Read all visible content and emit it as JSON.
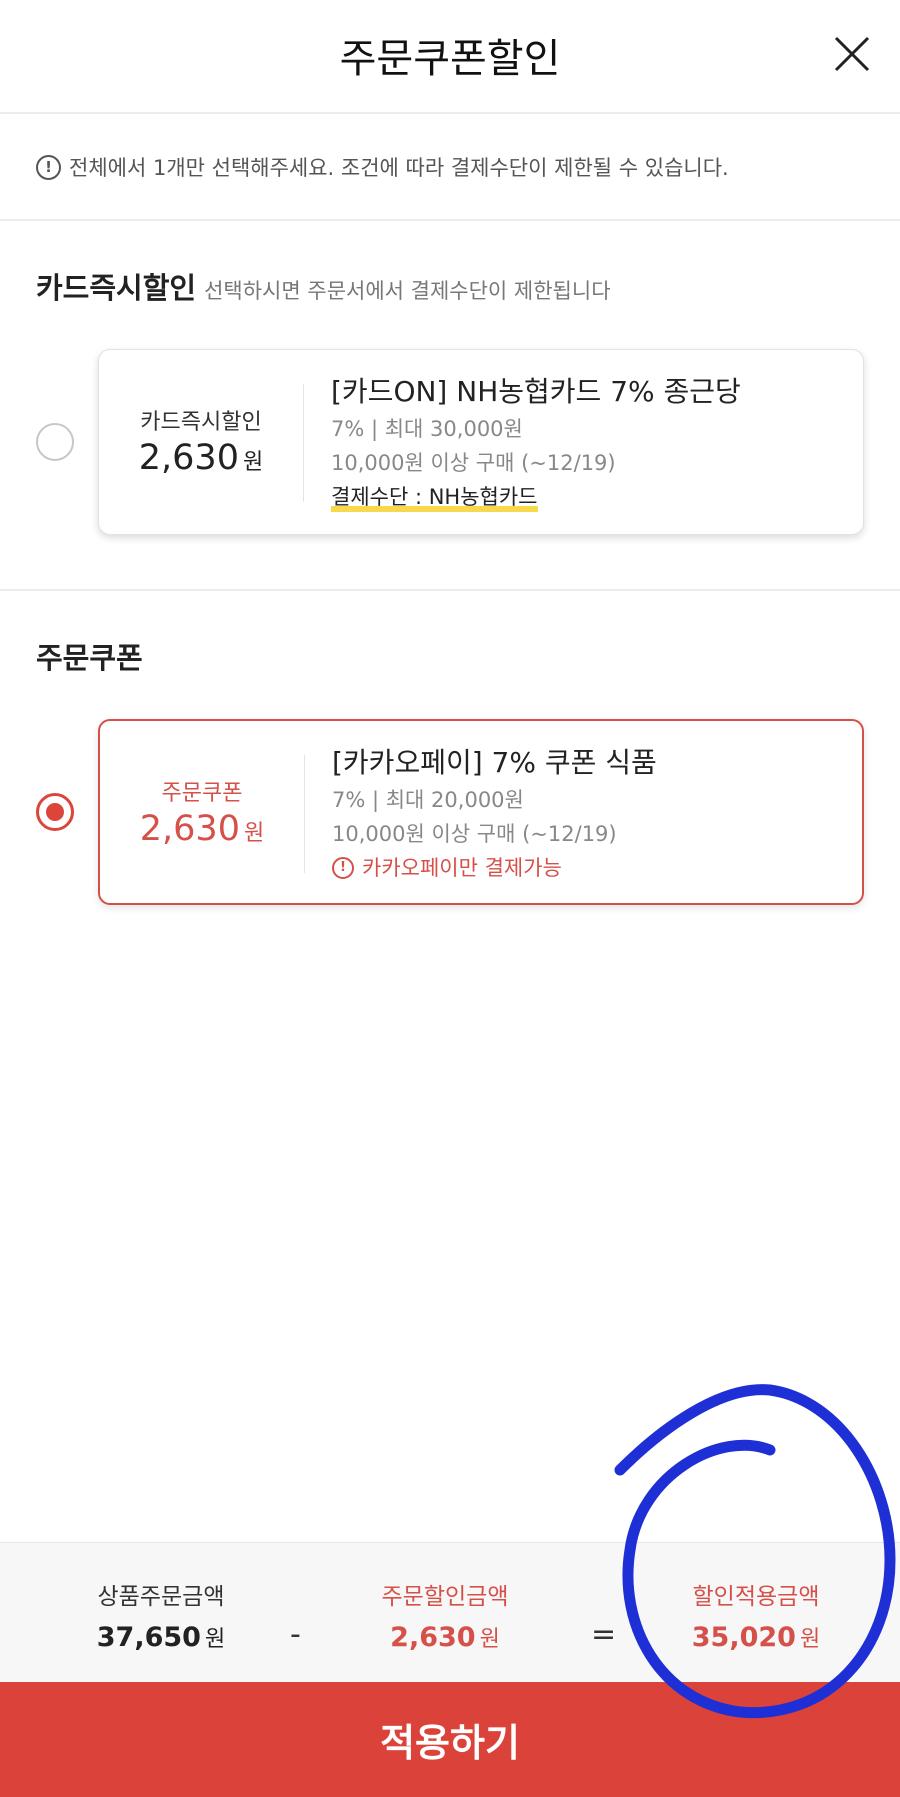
{
  "header": {
    "title": "주문쿠폰할인"
  },
  "notice": "전체에서 1개만 선택해주세요. 조건에 따라 결제수단이 제한될 수 있습니다.",
  "card_section": {
    "title": "카드즉시할인",
    "subtitle": "선택하시면 주문서에서 결제수단이 제한됩니다",
    "coupon": {
      "selected": false,
      "label": "카드즉시할인",
      "amount": "2,630",
      "unit": "원",
      "name": "[카드ON] NH농협카드 7% 종근당",
      "detail1": "7% | 최대 30,000원",
      "detail2": "10,000원 이상 구매 (~12/19)",
      "payment": "결제수단 : NH농협카드"
    }
  },
  "order_section": {
    "title": "주문쿠폰",
    "coupon": {
      "selected": true,
      "label": "주문쿠폰",
      "amount": "2,630",
      "unit": "원",
      "name": "[카카오페이] 7% 쿠폰 식품",
      "detail1": "7% | 최대 20,000원",
      "detail2": "10,000원 이상 구매 (~12/19)",
      "warning": "카카오페이만 결제가능"
    }
  },
  "summary": {
    "product": {
      "label": "상품주문금액",
      "value": "37,650",
      "unit": "원"
    },
    "minus": "-",
    "discount": {
      "label": "주문할인금액",
      "value": "2,630",
      "unit": "원"
    },
    "equals": "=",
    "final": {
      "label": "할인적용금액",
      "value": "35,020",
      "unit": "원"
    }
  },
  "apply_button": "적용하기",
  "colors": {
    "accent": "#db4239",
    "highlight": "#f7d94c",
    "annotation": "#1f2fd6"
  }
}
